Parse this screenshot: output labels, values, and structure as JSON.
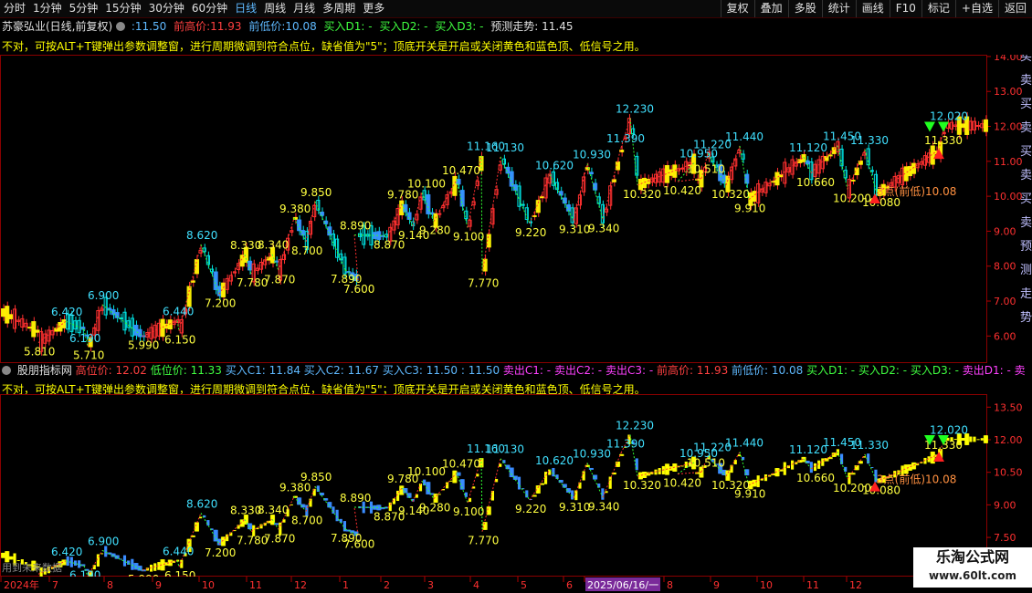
{
  "toolbar": {
    "left_items": [
      "分时",
      "1分钟",
      "5分钟",
      "15分钟",
      "30分钟",
      "60分钟",
      "日线",
      "周线",
      "月线",
      "多周期",
      "更多"
    ],
    "active_item": "日线",
    "right_items": [
      "复权",
      "叠加",
      "多股",
      "统计",
      "画线",
      "F10",
      "标记",
      "+自选",
      "返回"
    ]
  },
  "main_panel": {
    "title": "苏豪弘业(日线,前复权)",
    "value_current": ":11.50",
    "prev_high_label": "前高价:",
    "prev_high_value": "11.93",
    "prev_low_label": "前低价:",
    "prev_low_value": "10.08",
    "buy_d1": "买入D1: -",
    "buy_d2": "买入D2: -",
    "buy_d3": "买入D3: -",
    "forecast_label": "预测走势:",
    "forecast_value": "11.45",
    "note": "不对，可按ALT+T键弹出参数调整窗，进行周期微调到符合点位，缺省值为\"5\"；顶底开关是开启或关闭黄色和蓝色顶、低信号之用。",
    "y_axis": [
      "14.00",
      "13.00",
      "12.00",
      "11.00",
      "10.00",
      "9.00",
      "8.00",
      "7.00",
      "6.00"
    ],
    "annotation_text": "3点(前低)10.08",
    "right_strip": "买卖买卖买卖买卖预测走势"
  },
  "sub_panel": {
    "title": "股朋指标网",
    "fields": [
      {
        "label": "高位价:",
        "value": "12.02",
        "color": "#ff4040"
      },
      {
        "label": "低位价:",
        "value": "11.33",
        "color": "#40ff40"
      },
      {
        "label": "买入C1:",
        "value": "11.84",
        "color": "#5fb9ff"
      },
      {
        "label": "买入C2:",
        "value": "11.67",
        "color": "#5fb9ff"
      },
      {
        "label": "买入C3:",
        "value": "11.50",
        "color": "#5fb9ff"
      },
      {
        "label": ":",
        "value": "11.50",
        "color": "#5fb9ff"
      },
      {
        "label": "卖出C1:",
        "value": "-",
        "color": "#ff40ff"
      },
      {
        "label": "卖出C2:",
        "value": "-",
        "color": "#ff40ff"
      },
      {
        "label": "卖出C3:",
        "value": "-",
        "color": "#ff40ff"
      },
      {
        "label": "前高价:",
        "value": "11.93",
        "color": "#ff4040"
      },
      {
        "label": "前低价:",
        "value": "10.08",
        "color": "#5fb9ff"
      },
      {
        "label": "买入D1:",
        "value": "-",
        "color": "#40ff40"
      },
      {
        "label": "买入D2:",
        "value": "-",
        "color": "#40ff40"
      },
      {
        "label": "买入D3:",
        "value": "-",
        "color": "#40ff40"
      },
      {
        "label": "卖出D1:",
        "value": "-",
        "color": "#ff40ff"
      },
      {
        "label": "卖",
        "value": "",
        "color": "#ff40ff"
      }
    ],
    "note": "不对，可按ALT+T键弹出参数调整窗，进行周期微调到符合点位，缺省值为\"5\"；顶底开关是开启或关闭黄色和蓝色顶、低信号之用。",
    "y_axis": [
      "13.50",
      "12.00",
      "10.50",
      "9.00",
      "7.50"
    ],
    "footer_text": "用到未来数据"
  },
  "x_axis": {
    "labels": [
      "2024年",
      "7",
      "8",
      "9",
      "10",
      "11",
      "12",
      "1",
      "2",
      "3",
      "4",
      "5",
      "6",
      "2025/06/16/一",
      "8",
      "9",
      "10",
      "11",
      "12"
    ],
    "highlight": "2025/06/16/一"
  },
  "watermark": {
    "line1": "乐淘公式网",
    "line2": "www.60lt.com"
  },
  "pivots": [
    {
      "v": "5.810",
      "c": "y"
    },
    {
      "v": "6.420",
      "c": "c"
    },
    {
      "v": "6.190",
      "c": "c"
    },
    {
      "v": "5.710",
      "c": "y"
    },
    {
      "v": "6.900",
      "c": "c"
    },
    {
      "v": "5.990",
      "c": "y"
    },
    {
      "v": "6.440",
      "c": "c"
    },
    {
      "v": "6.150",
      "c": "y"
    },
    {
      "v": "8.620",
      "c": "c"
    },
    {
      "v": "7.200",
      "c": "y"
    },
    {
      "v": "8.330",
      "c": "y"
    },
    {
      "v": "7.780",
      "c": "y"
    },
    {
      "v": "8.340",
      "c": "y"
    },
    {
      "v": "7.870",
      "c": "y"
    },
    {
      "v": "9.380",
      "c": "y"
    },
    {
      "v": "8.700",
      "c": "y"
    },
    {
      "v": "9.850",
      "c": "y"
    },
    {
      "v": "7.890",
      "c": "y"
    },
    {
      "v": "7.600",
      "c": "y"
    },
    {
      "v": "8.890",
      "c": "y"
    },
    {
      "v": "8.870",
      "c": "y"
    },
    {
      "v": "9.780",
      "c": "y"
    },
    {
      "v": "9.140",
      "c": "y"
    },
    {
      "v": "10.100",
      "c": "y"
    },
    {
      "v": "9.280",
      "c": "y"
    },
    {
      "v": "10.470",
      "c": "y"
    },
    {
      "v": "9.100",
      "c": "y"
    },
    {
      "v": "11.160",
      "c": "c"
    },
    {
      "v": "7.770",
      "c": "y"
    },
    {
      "v": "11.130",
      "c": "c"
    },
    {
      "v": "9.220",
      "c": "y"
    },
    {
      "v": "10.620",
      "c": "c"
    },
    {
      "v": "9.310",
      "c": "y"
    },
    {
      "v": "10.930",
      "c": "c"
    },
    {
      "v": "9.340",
      "c": "y"
    },
    {
      "v": "11.390",
      "c": "c"
    },
    {
      "v": "12.230",
      "c": "c"
    },
    {
      "v": "10.320",
      "c": "y"
    },
    {
      "v": "10.950",
      "c": "c"
    },
    {
      "v": "10.420",
      "c": "y"
    },
    {
      "v": "10.510",
      "c": "y"
    },
    {
      "v": "11.220",
      "c": "c"
    },
    {
      "v": "10.320",
      "c": "y"
    },
    {
      "v": "11.440",
      "c": "c"
    },
    {
      "v": "9.910",
      "c": "y"
    },
    {
      "v": "11.120",
      "c": "c"
    },
    {
      "v": "10.660",
      "c": "y"
    },
    {
      "v": "11.450",
      "c": "c"
    },
    {
      "v": "10.200",
      "c": "y"
    },
    {
      "v": "11.330",
      "c": "c"
    },
    {
      "v": "10.080",
      "c": "y"
    },
    {
      "v": "11.330",
      "c": "y"
    },
    {
      "v": "12.020",
      "c": "c"
    }
  ]
}
